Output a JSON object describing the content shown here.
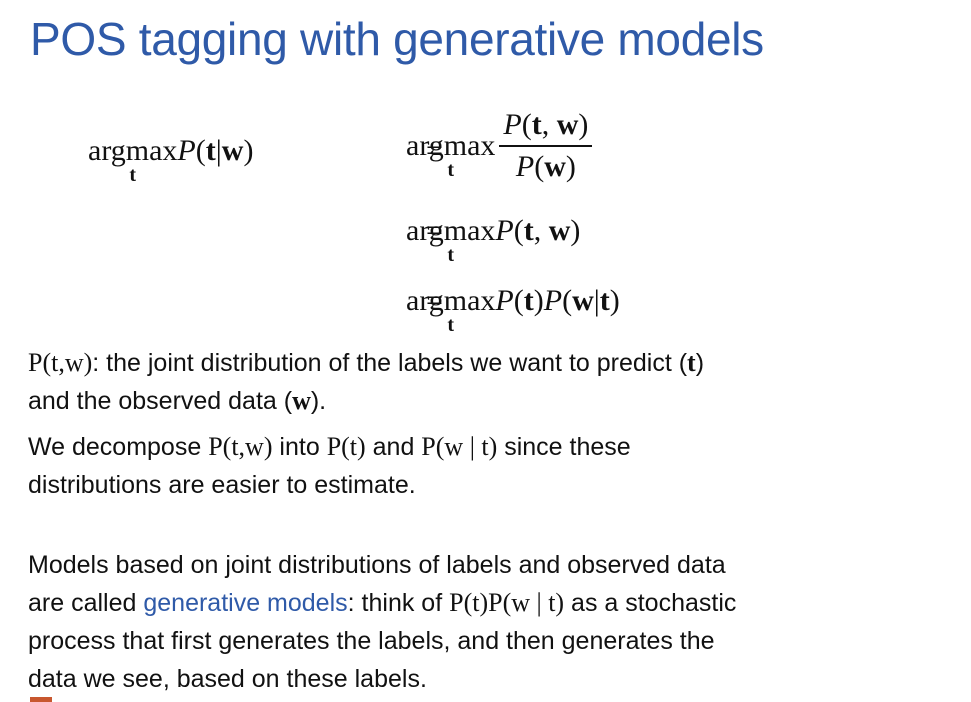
{
  "title": "POS tagging with generative models",
  "equations": {
    "argmax": "argmax",
    "sub": "t",
    "eq": "=",
    "P": "P",
    "t": "t",
    "w": "w",
    "bar": "|",
    "comma": ",",
    "lp": "(",
    "rp": ")"
  },
  "para1": {
    "term": "P(t,w)",
    "text": ": the joint distribution of the labels we want to predict (",
    "t": "t",
    "text2": ")",
    "line2": "and the observed data (",
    "w": "w",
    "line2_end": ")."
  },
  "para2": {
    "text1": "We decompose ",
    "term1": "P(t,w)",
    "text2": " into ",
    "term2": "P(t)",
    "text3": " and ",
    "term3": "P(w | t)",
    "text4": " since these",
    "line2": "distributions are easier to estimate."
  },
  "para3": {
    "line1": "Models based on joint distributions of labels and observed data",
    "line2a": "are called ",
    "highlight": "generative models",
    "line2b": ": think of ",
    "term": "P(t)P(w | t)",
    "line2c": " as a stochastic",
    "line3": "process that first generates the labels, and then generates the",
    "line4": "data we see, based on these labels."
  },
  "colors": {
    "title": "#2f5aa8",
    "highlight": "#2f5aa8",
    "text": "#111111",
    "corner_mark": "#c8572f"
  }
}
